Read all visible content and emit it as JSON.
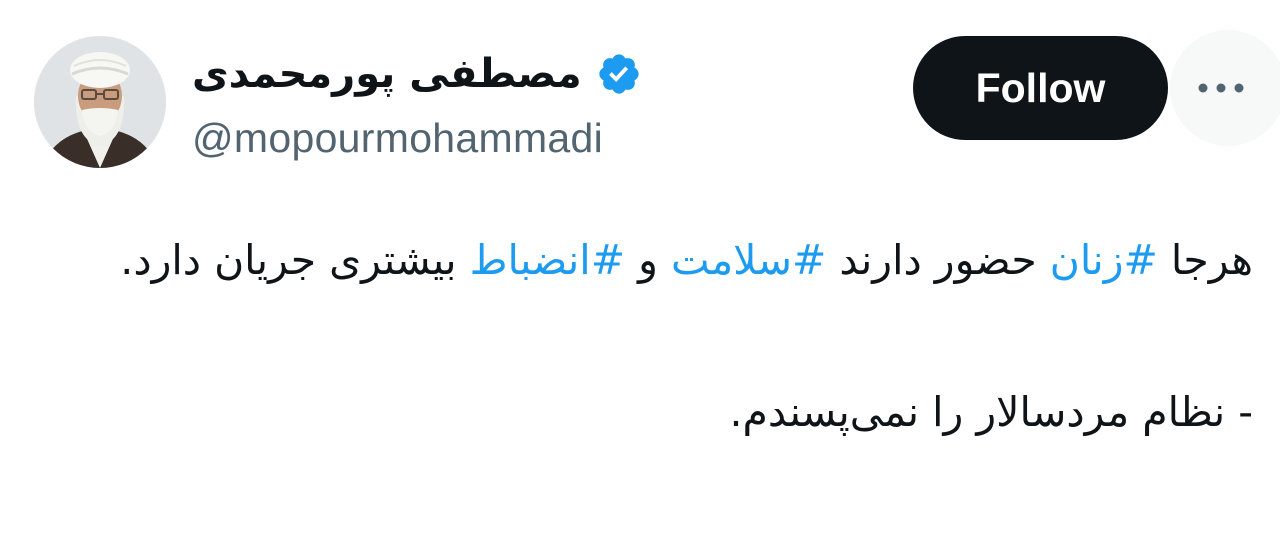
{
  "profile": {
    "display_name": "مصطفی پورمحمدی",
    "handle": "@mopourmohammadi",
    "verified": true
  },
  "actions": {
    "follow_label": "Follow"
  },
  "icons": {
    "verified": "verified-badge-icon",
    "more": "more-horizontal-icon"
  },
  "tweet": {
    "line1": {
      "w1": "هرجا ",
      "tag1": "#زنان",
      "w2": " حضور دارند ",
      "tag2": "#سلامت",
      "w3": " و ",
      "tag3": "#انضباط",
      "w4": " بیشتری جریان دارد."
    },
    "line2": "- نظام مردسالار را نمی‌پسندم."
  },
  "colors": {
    "text": "#0f1419",
    "secondary": "#536471",
    "link": "#1d9bf0",
    "button": "#0f1419",
    "more_bg": "#f7f9f9"
  }
}
